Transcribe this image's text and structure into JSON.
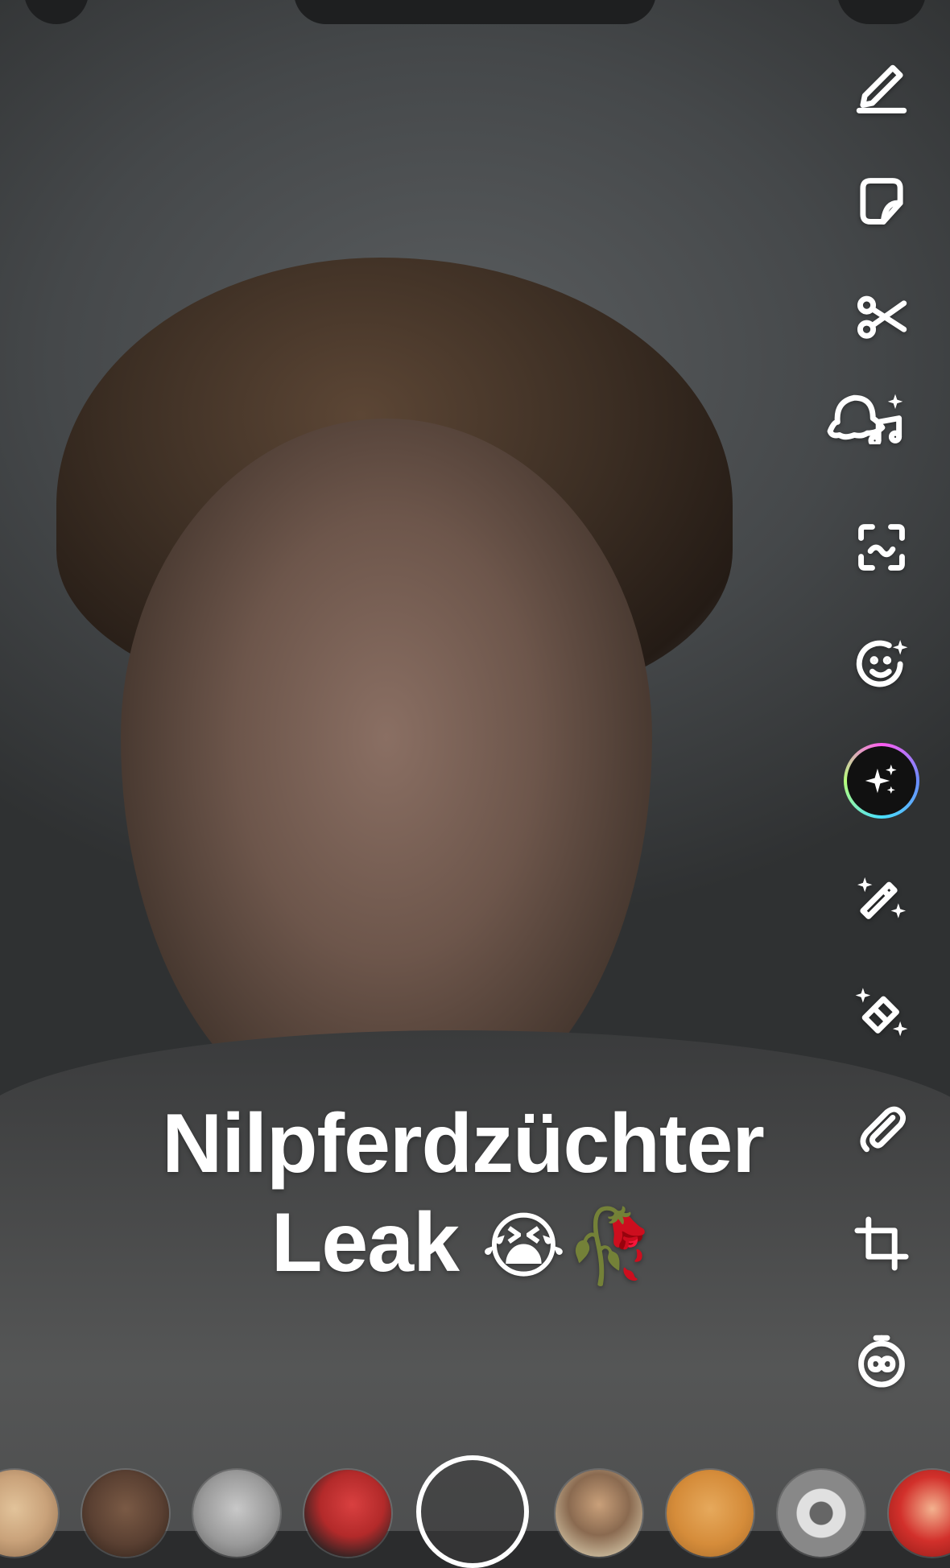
{
  "caption": {
    "line1": "Nilpferdzüchter",
    "line2": "Leak",
    "emoji": "😭🥀"
  },
  "toolbar": {
    "tools": [
      {
        "name": "pencil-icon",
        "label": "Draw"
      },
      {
        "name": "sticker-icon",
        "label": "Sticker"
      },
      {
        "name": "scissors-icon",
        "label": "Scissors"
      },
      {
        "name": "music-icon",
        "label": "Music"
      },
      {
        "name": "scan-icon",
        "label": "Scan"
      },
      {
        "name": "lens-smile-icon",
        "label": "Lenses"
      },
      {
        "name": "ai-sparkle-icon",
        "label": "AI"
      },
      {
        "name": "magic-wand-icon",
        "label": "Magic wand"
      },
      {
        "name": "magic-eraser-icon",
        "label": "Magic eraser"
      },
      {
        "name": "paperclip-icon",
        "label": "Link"
      },
      {
        "name": "crop-icon",
        "label": "Crop"
      },
      {
        "name": "timer-icon",
        "label": "Timer"
      }
    ]
  },
  "lens_carousel": {
    "items": [
      {
        "name": "lens-dog",
        "color": "#c9a27a"
      },
      {
        "name": "lens-man",
        "color": "#5a4032"
      },
      {
        "name": "lens-child-bw",
        "color": "#9a9a9a"
      },
      {
        "name": "lens-spiderman",
        "color": "#b32a2a"
      },
      {
        "name": "lens-sunglasses",
        "color": "#4fa3c9"
      },
      {
        "name": "lens-cat",
        "color": "#d58c3a"
      },
      {
        "name": "lens-bw-ring",
        "color": "#d8d8d8"
      },
      {
        "name": "lens-red",
        "color": "#d2302b"
      }
    ]
  },
  "colors": {
    "accent_ring": [
      "#ff5cf1",
      "#6a8cff",
      "#49e0ff",
      "#b6ff7a"
    ],
    "icon": "#ffffff"
  }
}
